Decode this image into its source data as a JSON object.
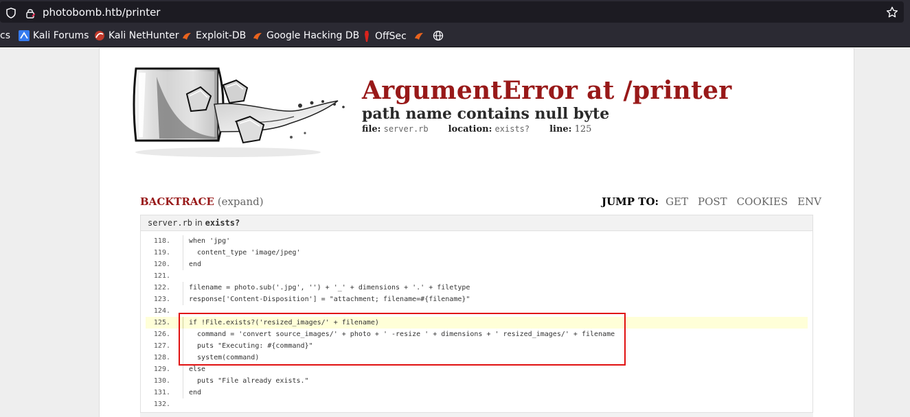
{
  "browser": {
    "url": "photobomb.htb/printer",
    "bookmarks": [
      {
        "label": "cs",
        "icon": "none"
      },
      {
        "label": "Kali Forums",
        "icon": "kali-forums-icon"
      },
      {
        "label": "Kali NetHunter",
        "icon": "kali-nethunter-icon"
      },
      {
        "label": "Exploit-DB",
        "icon": "exploitdb-icon"
      },
      {
        "label": "Google Hacking DB",
        "icon": "ghdb-icon"
      },
      {
        "label": "OffSec",
        "icon": "offsec-icon"
      }
    ]
  },
  "error": {
    "title": "ArgumentError at /printer",
    "subtitle": "path name contains null byte",
    "file_label": "file:",
    "file": "server.rb",
    "location_label": "location:",
    "location": "exists?",
    "line_label": "line:",
    "line": "125"
  },
  "backtrace": {
    "label": "BACKTRACE",
    "expand": "(expand)",
    "jump_label": "JUMP TO:",
    "jump_links": [
      "GET",
      "POST",
      "COOKIES",
      "ENV"
    ]
  },
  "frame": {
    "file": "server.rb",
    "in_text": "in",
    "method": "exists?",
    "highlight_line": "125",
    "lines": [
      {
        "n": "118.",
        "code": "when 'jpg'"
      },
      {
        "n": "119.",
        "code": "  content_type 'image/jpeg'"
      },
      {
        "n": "120.",
        "code": "end"
      },
      {
        "n": "121.",
        "code": ""
      },
      {
        "n": "122.",
        "code": "filename = photo.sub('.jpg', '') + '_' + dimensions + '.' + filetype"
      },
      {
        "n": "123.",
        "code": "response['Content-Disposition'] = \"attachment; filename=#{filename}\""
      },
      {
        "n": "124.",
        "code": ""
      },
      {
        "n": "125.",
        "code": "if !File.exists?('resized_images/' + filename)"
      },
      {
        "n": "126.",
        "code": "  command = 'convert source_images/' + photo + ' -resize ' + dimensions + ' resized_images/' + filename"
      },
      {
        "n": "127.",
        "code": "  puts \"Executing: #{command}\""
      },
      {
        "n": "128.",
        "code": "  system(command)"
      },
      {
        "n": "129.",
        "code": "else"
      },
      {
        "n": "130.",
        "code": "  puts \"File already exists.\""
      },
      {
        "n": "131.",
        "code": "end"
      },
      {
        "n": "132.",
        "code": ""
      }
    ]
  },
  "colors": {
    "accent": "#981919",
    "annotation_box": "#e01010",
    "highlight": "#ffffd8"
  }
}
